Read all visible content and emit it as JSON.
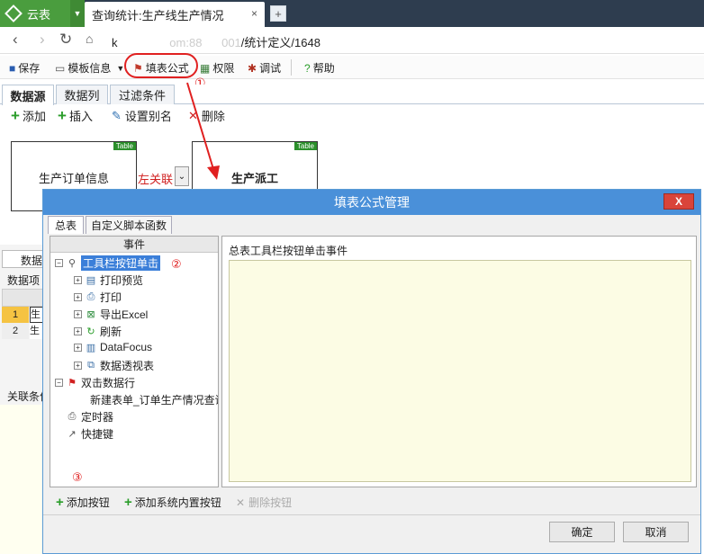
{
  "browser": {
    "brand": "云表",
    "tab_title": "查询统计:生产线生产情况",
    "tab_close": "×",
    "new_tab": "+",
    "url_prefix": "k",
    "url_host_blur": "                om:88      001",
    "url_path": "/统计定义/1648"
  },
  "toolbar": {
    "items": [
      "保存",
      "模板信息",
      "填表公式",
      "权限",
      "调试",
      "帮助"
    ],
    "annotation_1": "①"
  },
  "tabs": [
    "数据源",
    "数据列",
    "过滤条件"
  ],
  "actions": [
    "添加",
    "插入",
    "设置别名",
    "删除"
  ],
  "canvas": {
    "table1": "生产订单信息",
    "table2": "生产派工",
    "tag": "Table",
    "join": "左关联"
  },
  "background": {
    "data_tab": "数据",
    "data_label": "数据项",
    "rows": [
      "1",
      "2"
    ],
    "row_vals": [
      "生",
      "生"
    ],
    "cond_label": "关联条件"
  },
  "dialog": {
    "title": "填表公式管理",
    "close": "X",
    "tabs": [
      "总表",
      "自定义脚本函数"
    ],
    "tree_header": "事件",
    "tree": {
      "root": "工具栏按钮单击",
      "children": [
        "打印预览",
        "打印",
        "导出Excel",
        "刷新",
        "DataFocus",
        "数据透视表"
      ],
      "dblclick": "双击数据行",
      "dblclick_child": "新建表单_订单生产情况查询",
      "timer": "定时器",
      "shortcut": "快捷键"
    },
    "annotation_2": "②",
    "annotation_3": "③",
    "editor_title": "总表工具栏按钮单击事件",
    "bottom_actions": [
      "添加按钮",
      "添加系统内置按钮",
      "删除按钮"
    ],
    "ok": "确定",
    "cancel": "取消"
  },
  "colors": {
    "accent_red": "#e02020",
    "dialog_blue": "#4a90d9",
    "brand_green": "#4a9d3e",
    "selection_blue": "#3b7fd9"
  }
}
